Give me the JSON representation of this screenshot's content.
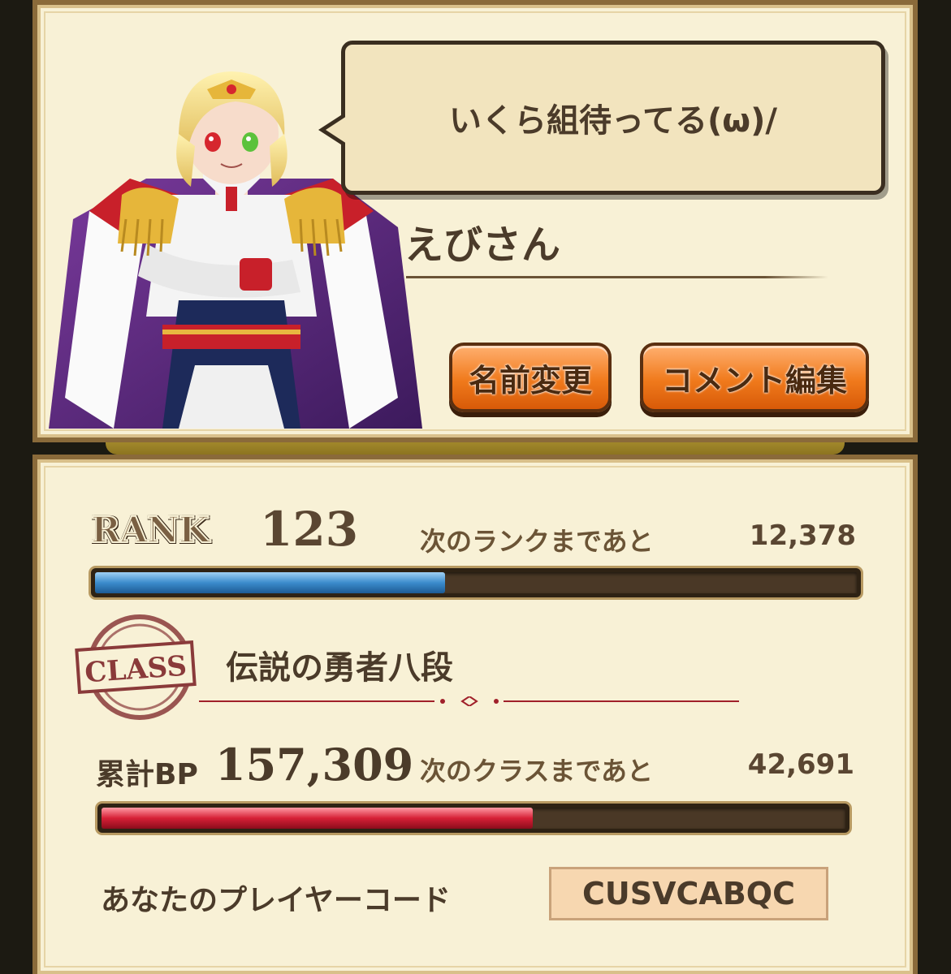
{
  "profile": {
    "comment": "いくら組待ってる(ω)/",
    "player_name": "えびさん",
    "change_name_button": "名前変更",
    "edit_comment_button": "コメント編集"
  },
  "rank": {
    "badge_label": "RANK",
    "value": "123",
    "next_label": "次のランクまであと",
    "next_value": "12,378",
    "progress_fraction": 0.46,
    "bar_color": "#3b8ccc"
  },
  "class": {
    "stamp_label": "CLASS",
    "name": "伝説の勇者八段",
    "bp_label": "累計BP",
    "bp_value": "157,309",
    "next_label": "次のクラスまであと",
    "next_value": "42,691",
    "progress_fraction": 0.58,
    "bar_color": "#d62036"
  },
  "player_code": {
    "label": "あなたのプレイヤーコード",
    "value": "CUSVCABQC"
  },
  "icons": {
    "avatar": "character-portrait-icon",
    "stamp": "class-stamp-icon"
  }
}
